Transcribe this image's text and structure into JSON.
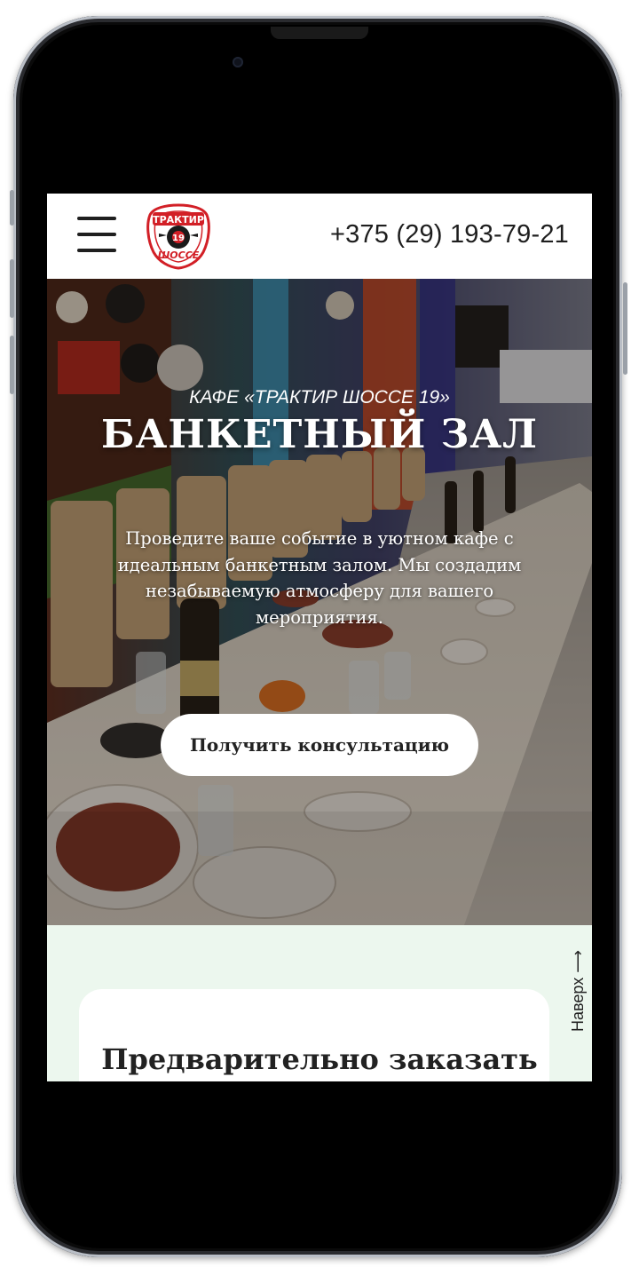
{
  "header": {
    "menu_icon": "hamburger-menu-icon",
    "logo": {
      "top_text": "ТРАКТИР",
      "number": "19",
      "bottom_text": "ШОССЕ",
      "color": "#d21f26"
    },
    "phone": "+375 (29) 193-79-21"
  },
  "hero": {
    "kicker": "КАФЕ «ТРАКТИР ШОССЕ 19»",
    "title": "БАНКЕТНЫЙ ЗАЛ",
    "description": "Проведите ваше событие в уютном кафе с идеальным банкетным залом. Мы создадим незабываемую атмосферу для вашего мероприятия.",
    "cta_label": "Получить консультацию"
  },
  "order_section": {
    "title": "Предварительно заказать",
    "to_top_label": "Наверх ⟶"
  },
  "colors": {
    "brand_red": "#d21f26",
    "section_bg": "#ecf7ee",
    "text_dark": "#222222"
  }
}
